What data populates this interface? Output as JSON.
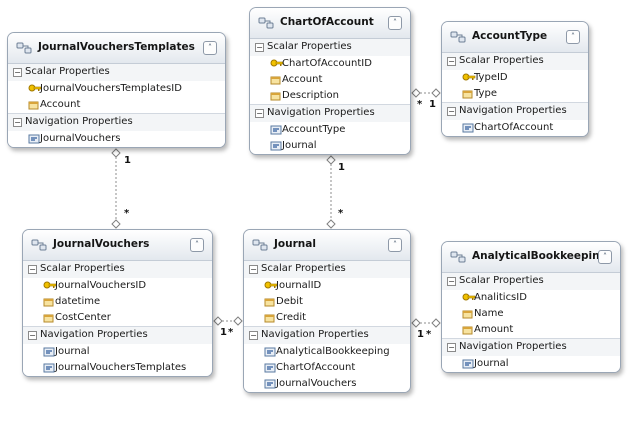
{
  "diagram": {
    "section_labels": {
      "scalar": "Scalar Properties",
      "navigation": "Navigation Properties"
    },
    "entities": {
      "journal_vouchers_templates": {
        "title": "JournalVouchersTemplates",
        "scalar": [
          {
            "name": "JournalVouchersTemplatesID",
            "key": true
          },
          {
            "name": "Account",
            "key": false
          }
        ],
        "navigation": [
          "JournalVouchers"
        ]
      },
      "chart_of_account": {
        "title": "ChartOfAccount",
        "scalar": [
          {
            "name": "ChartOfAccountID",
            "key": true
          },
          {
            "name": "Account",
            "key": false
          },
          {
            "name": "Description",
            "key": false
          }
        ],
        "navigation": [
          "AccountType",
          "Journal"
        ]
      },
      "account_type": {
        "title": "AccountType",
        "scalar": [
          {
            "name": "TypeID",
            "key": true
          },
          {
            "name": "Type",
            "key": false
          }
        ],
        "navigation": [
          "ChartOfAccount"
        ]
      },
      "journal_vouchers": {
        "title": "JournalVouchers",
        "scalar": [
          {
            "name": "JournalVouchersID",
            "key": true
          },
          {
            "name": "datetime",
            "key": false
          },
          {
            "name": "CostCenter",
            "key": false
          }
        ],
        "navigation": [
          "Journal",
          "JournalVouchersTemplates"
        ]
      },
      "journal": {
        "title": "Journal",
        "scalar": [
          {
            "name": "JournalID",
            "key": true
          },
          {
            "name": "Debit",
            "key": false
          },
          {
            "name": "Credit",
            "key": false
          }
        ],
        "navigation": [
          "AnalyticalBookkeeping",
          "ChartOfAccount",
          "JournalVouchers"
        ]
      },
      "analytical_bookkeeping": {
        "title": "AnalyticalBookkeeping",
        "scalar": [
          {
            "name": "AnaliticsID",
            "key": true
          },
          {
            "name": "Name",
            "key": false
          },
          {
            "name": "Amount",
            "key": false
          }
        ],
        "navigation": [
          "Journal"
        ]
      }
    },
    "associations": [
      {
        "from": "JournalVouchersTemplates",
        "to": "JournalVouchers",
        "from_mult": "1",
        "to_mult": "*"
      },
      {
        "from": "ChartOfAccount",
        "to": "AccountType",
        "from_mult": "*",
        "to_mult": "1"
      },
      {
        "from": "ChartOfAccount",
        "to": "Journal",
        "from_mult": "1",
        "to_mult": "*"
      },
      {
        "from": "JournalVouchers",
        "to": "Journal",
        "from_mult": "1",
        "to_mult": "*"
      },
      {
        "from": "Journal",
        "to": "AnalyticalBookkeeping",
        "from_mult": "1",
        "to_mult": "*"
      }
    ]
  },
  "colors": {
    "entity_border": "#9aa6b5",
    "header_gradient_top": "#ffffff",
    "header_gradient_bottom": "#e3e8ee",
    "key_icon": "#d8a400",
    "wire": "#8c8c8c"
  },
  "icons": {
    "entity": "entity-type-icon",
    "collapse": "chevron-collapse-icon",
    "key_property": "key-property-icon",
    "property": "property-icon",
    "navigation": "navigation-property-icon"
  }
}
